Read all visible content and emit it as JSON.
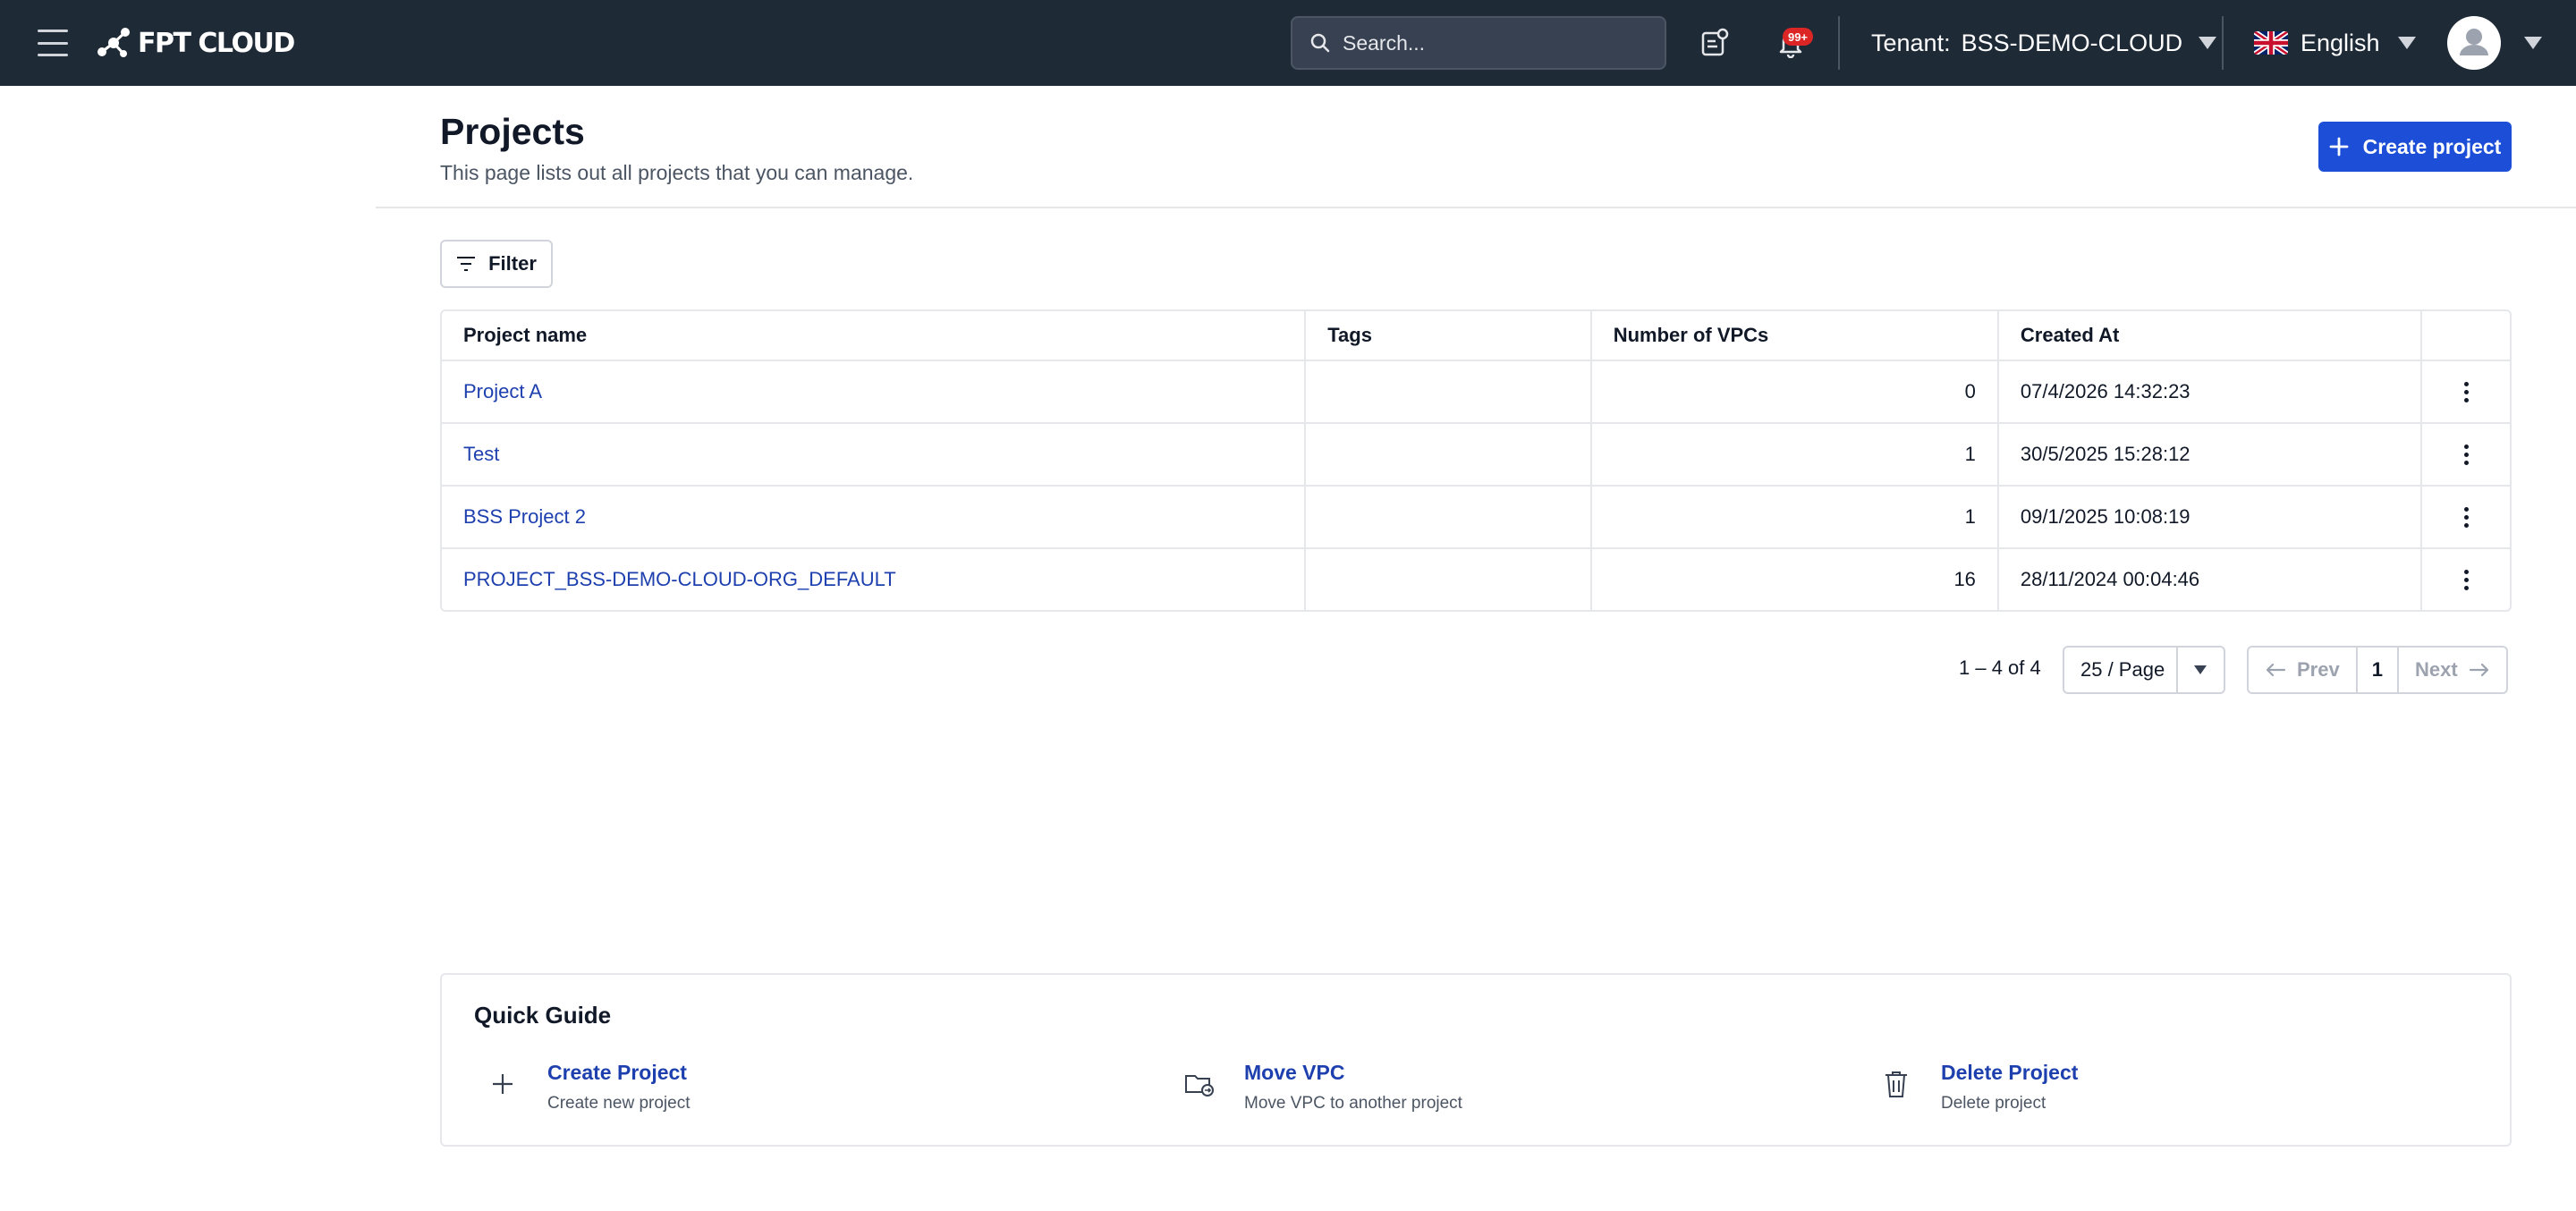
{
  "header": {
    "brand": "FPT CLOUD",
    "search_placeholder": "Search...",
    "notification_badge": "99+",
    "tenant_label": "Tenant:",
    "tenant_value": "BSS-DEMO-CLOUD",
    "language": "English",
    "icons": [
      "hamburger-icon",
      "search-icon",
      "clipboard-notification-icon",
      "bell-icon",
      "uk-flag-icon",
      "user-avatar-icon"
    ]
  },
  "page": {
    "title": "Projects",
    "subtitle": "This page lists out all projects that you can manage.",
    "create_label": "Create project",
    "filter_label": "Filter"
  },
  "table": {
    "columns": [
      "Project name",
      "Tags",
      "Number of VPCs",
      "Created At",
      ""
    ],
    "rows": [
      {
        "name": "Project A",
        "tags": "",
        "vpcs": "0",
        "created": "07/4/2026 14:32:23"
      },
      {
        "name": "Test",
        "tags": "",
        "vpcs": "1",
        "created": "30/5/2025 15:28:12"
      },
      {
        "name": "BSS Project 2",
        "tags": "",
        "vpcs": "1",
        "created": "09/1/2025 10:08:19"
      },
      {
        "name": "PROJECT_BSS-DEMO-CLOUD-ORG_DEFAULT",
        "tags": "",
        "vpcs": "16",
        "created": "28/11/2024 00:04:46"
      }
    ]
  },
  "pagination": {
    "range": "1 – 4 of 4",
    "per_page": "25 / Page",
    "prev": "Prev",
    "current": "1",
    "next": "Next"
  },
  "quick_guide": {
    "title": "Quick Guide",
    "items": [
      {
        "name": "Create Project",
        "desc": "Create new project",
        "icon": "plus-icon"
      },
      {
        "name": "Move VPC",
        "desc": "Move VPC to another project",
        "icon": "folder-move-icon"
      },
      {
        "name": "Delete Project",
        "desc": "Delete project",
        "icon": "trash-icon"
      }
    ]
  },
  "colors": {
    "topbar": "#1f2a37",
    "primary": "#1d4ed8",
    "link": "#1e40af",
    "badge": "#dc2626"
  }
}
